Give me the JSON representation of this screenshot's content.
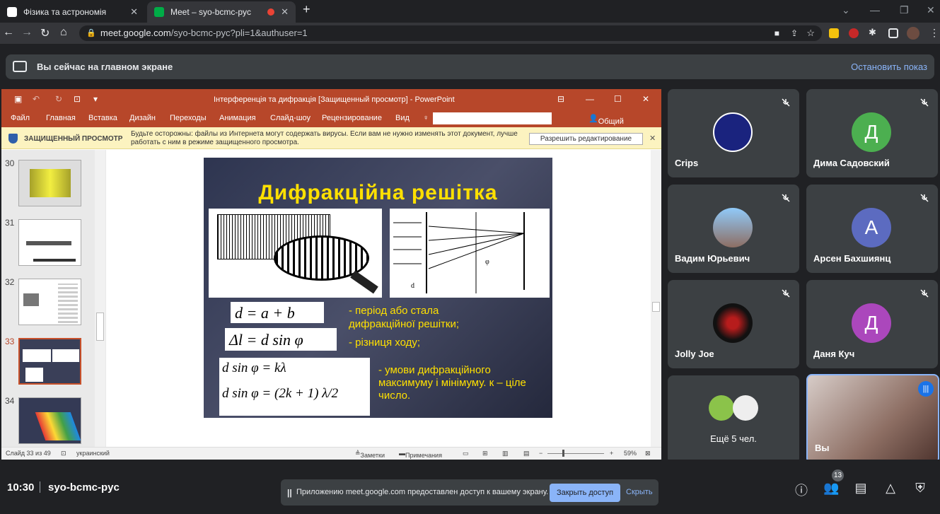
{
  "browser": {
    "tabs": [
      {
        "label": "Фізика та астрономія"
      },
      {
        "label": "Meet – syo-bcmc-pyc"
      }
    ],
    "url_host": "meet.google.com",
    "url_path": "/syo-bcmc-pyc?pli=1&authuser=1"
  },
  "meet": {
    "banner_text": "Вы сейчас на главном экране",
    "stop_label": "Остановить показ",
    "time": "10:30",
    "meeting_code": "syo-bcmc-pyc",
    "notice_text": "Приложению meet.google.com предоставлен доступ к вашему экрану.",
    "close_access": "Закрыть доступ",
    "hide": "Скрыть",
    "participants_count": "13",
    "participants": [
      {
        "name": "Crips",
        "initial": ""
      },
      {
        "name": "Дима Садовский",
        "initial": "Д",
        "color": "#4caf50"
      },
      {
        "name": "Вадим Юрьевич",
        "initial": ""
      },
      {
        "name": "Арсен Бахшиянц",
        "initial": "А",
        "color": "#5c6bc0"
      },
      {
        "name": "Jolly Joe",
        "initial": ""
      },
      {
        "name": "Даня Куч",
        "initial": "Д",
        "color": "#ab47bc"
      },
      {
        "name": "Ещё 5 чел.",
        "initial": ""
      },
      {
        "name": "Вы",
        "initial": ""
      }
    ]
  },
  "ppt": {
    "title": "Інтерференція та дифракція [Защищенный просмотр] - PowerPoint",
    "menu": [
      "Файл",
      "Главная",
      "Вставка",
      "Дизайн",
      "Переходы",
      "Анимация",
      "Слайд-шоу",
      "Рецензирование",
      "Вид"
    ],
    "share": "Общий доступ",
    "pv_label": "ЗАЩИЩЕННЫЙ ПРОСМОТР",
    "pv_msg": "Будьте осторожны: файлы из Интернета могут содержать вирусы. Если вам не нужно изменять этот документ, лучше работать с ним в режиме защищенного просмотра.",
    "pv_button": "Разрешить редактирование",
    "thumb_nums": [
      "30",
      "31",
      "32",
      "33",
      "34"
    ],
    "status_slide": "Слайд 33 из 49",
    "status_lang": "украинский",
    "notes": "Заметки",
    "comments": "Примечания",
    "zoom": "59%"
  },
  "slide": {
    "title": "Дифракційна решітка",
    "f1": "d = a + b",
    "f2": "Δl = d sin φ",
    "f3": "d sin φ = kλ",
    "f4": "d sin φ = (2k + 1) λ/2",
    "t1": "- період або стала дифракційної решітки;",
    "t2": "- різниця ходу;",
    "t3": "- умови дифракційного максимуму і мінімуму. к – ціле число."
  },
  "colors": {
    "ppt_red": "#b7472a",
    "meet_blue": "#8ab4f8",
    "yellow": "#ffe000"
  }
}
